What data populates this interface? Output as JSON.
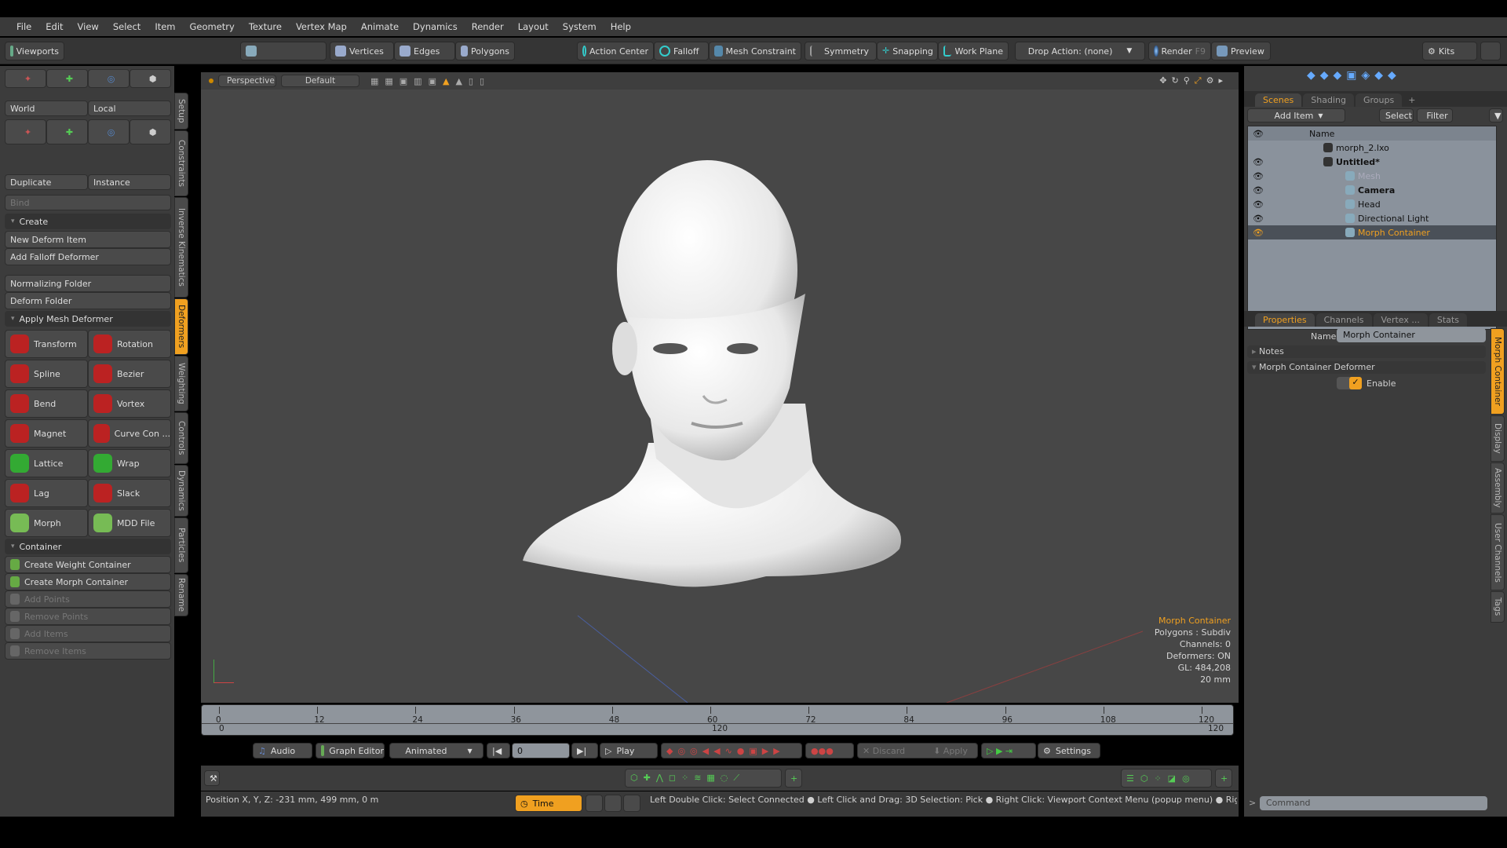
{
  "menu": [
    "File",
    "Edit",
    "View",
    "Select",
    "Item",
    "Geometry",
    "Texture",
    "Vertex Map",
    "Animate",
    "Dynamics",
    "Render",
    "Layout",
    "System",
    "Help"
  ],
  "toolbar": {
    "viewports": "Viewports",
    "vertices": "Vertices",
    "edges": "Edges",
    "polygons": "Polygons",
    "action_center": "Action Center",
    "falloff": "Falloff",
    "mesh_constraint": "Mesh Constraint",
    "symmetry": "Symmetry",
    "snapping": "Snapping",
    "work_plane": "Work Plane",
    "drop_action": "Drop Action: (none)",
    "render": "Render",
    "render_key": "F9",
    "preview": "Preview",
    "kits": "Kits"
  },
  "left": {
    "world": "World",
    "local": "Local",
    "duplicate": "Duplicate",
    "instance": "Instance",
    "bind": "Bind",
    "create": "Create",
    "new_deform": "New Deform Item",
    "add_falloff": "Add Falloff Deformer",
    "normalizing": "Normalizing Folder",
    "deform_folder": "Deform Folder",
    "apply_mesh": "Apply Mesh Deformer",
    "deformers": [
      [
        "Transform",
        "Rotation"
      ],
      [
        "Spline",
        "Bezier"
      ],
      [
        "Bend",
        "Vortex"
      ],
      [
        "Magnet",
        "Curve Con ..."
      ],
      [
        "Lattice",
        "Wrap"
      ],
      [
        "Lag",
        "Slack"
      ],
      [
        "Morph",
        "MDD File"
      ]
    ],
    "container": "Container",
    "container_items": [
      {
        "label": "Create Weight Container",
        "enabled": true
      },
      {
        "label": "Create Morph Container",
        "enabled": true
      },
      {
        "label": "Add Points",
        "enabled": false
      },
      {
        "label": "Remove Points",
        "enabled": false
      },
      {
        "label": "Add Items",
        "enabled": false
      },
      {
        "label": "Remove Items",
        "enabled": false
      }
    ],
    "tabs": [
      "Setup",
      "Constraints",
      "Inverse Kinematics",
      "Deformers",
      "Weighting",
      "Controls",
      "Dynamics",
      "Particles",
      "Rename"
    ],
    "active_tab": "Deformers"
  },
  "viewport": {
    "view": "Perspective",
    "shading": "Default",
    "info": {
      "item": "Morph Container",
      "polygons": "Polygons : Subdiv",
      "channels": "Channels: 0",
      "deformers": "Deformers: ON",
      "gl": "GL: 484,208",
      "scale": "20 mm"
    }
  },
  "scenes": {
    "tabs": [
      "Scenes",
      "Shading",
      "Groups"
    ],
    "add_item": "Add Item",
    "select": "Select",
    "filter": "Filter",
    "name_col": "Name",
    "items": [
      {
        "label": "morph_2.lxo",
        "depth": 0,
        "bold": false,
        "eye": false
      },
      {
        "label": "Untitled*",
        "depth": 0,
        "bold": true,
        "eye": true
      },
      {
        "label": "Mesh",
        "depth": 1,
        "bold": false,
        "eye": true,
        "dim": true
      },
      {
        "label": "Camera",
        "depth": 1,
        "bold": true,
        "eye": true
      },
      {
        "label": "Head",
        "depth": 1,
        "bold": false,
        "eye": true
      },
      {
        "label": "Directional Light",
        "depth": 1,
        "bold": false,
        "eye": true
      },
      {
        "label": "Morph Container",
        "depth": 1,
        "bold": false,
        "eye": true,
        "selected": true
      }
    ]
  },
  "properties": {
    "tabs": [
      "Properties",
      "Channels",
      "Vertex ...",
      "Stats"
    ],
    "name_label": "Name",
    "name_value": "Morph Container",
    "notes": "Notes",
    "section": "Morph Container Deformer",
    "enable": "Enable",
    "enabled": true,
    "side_tabs": [
      "Morph Container",
      "Display",
      "Assembly",
      "User Channels",
      "Tags"
    ]
  },
  "timeline": {
    "ticks": [
      "0",
      "12",
      "24",
      "36",
      "48",
      "60",
      "72",
      "84",
      "96",
      "108",
      "120"
    ],
    "range_start": "0",
    "range_mid": "120",
    "range_end": "120"
  },
  "transport": {
    "audio": "Audio",
    "graph_editor": "Graph Editor",
    "mode": "Animated",
    "frame": "0",
    "play": "Play",
    "discard": "Discard",
    "apply": "Apply",
    "settings": "Settings"
  },
  "status": {
    "position": "Position X, Y, Z:   -231 mm, 499 mm, 0 m",
    "time": "Time",
    "hint": "Left Double Click: Select Connected ● Left Click and Drag: 3D Selection: Pick ● Right Click: Viewport Context Menu (popup menu) ● Right Click and Dra...",
    "command_placeholder": "Command"
  },
  "colors": {
    "accent": "#f0a020",
    "panel": "#3c3c3c",
    "viewport": "#474747"
  }
}
